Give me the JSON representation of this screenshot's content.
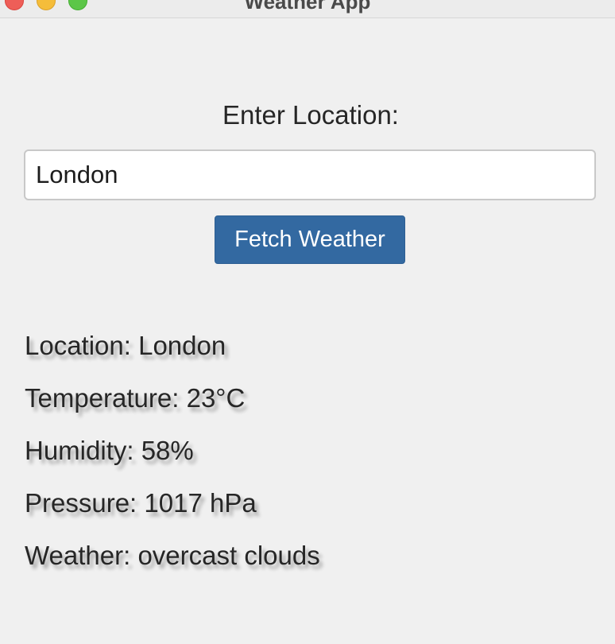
{
  "window": {
    "title": "Weather App"
  },
  "form": {
    "prompt_label": "Enter Location:",
    "location_value": "London",
    "fetch_button_label": "Fetch Weather"
  },
  "results": {
    "location": "Location: London",
    "temperature": "Temperature: 23°C",
    "humidity": "Humidity: 58%",
    "pressure": "Pressure: 1017 hPa",
    "weather": "Weather: overcast clouds"
  },
  "colors": {
    "background": "#f0f0f0",
    "button_bg": "#3369a1",
    "button_text": "#ffffff",
    "text": "#262626",
    "close_light": "#ee5e58",
    "minimize_light": "#f5bd3a",
    "maximize_light": "#5cc648"
  },
  "icons": {
    "close": "close-icon",
    "minimize": "minimize-icon",
    "maximize": "maximize-icon"
  }
}
